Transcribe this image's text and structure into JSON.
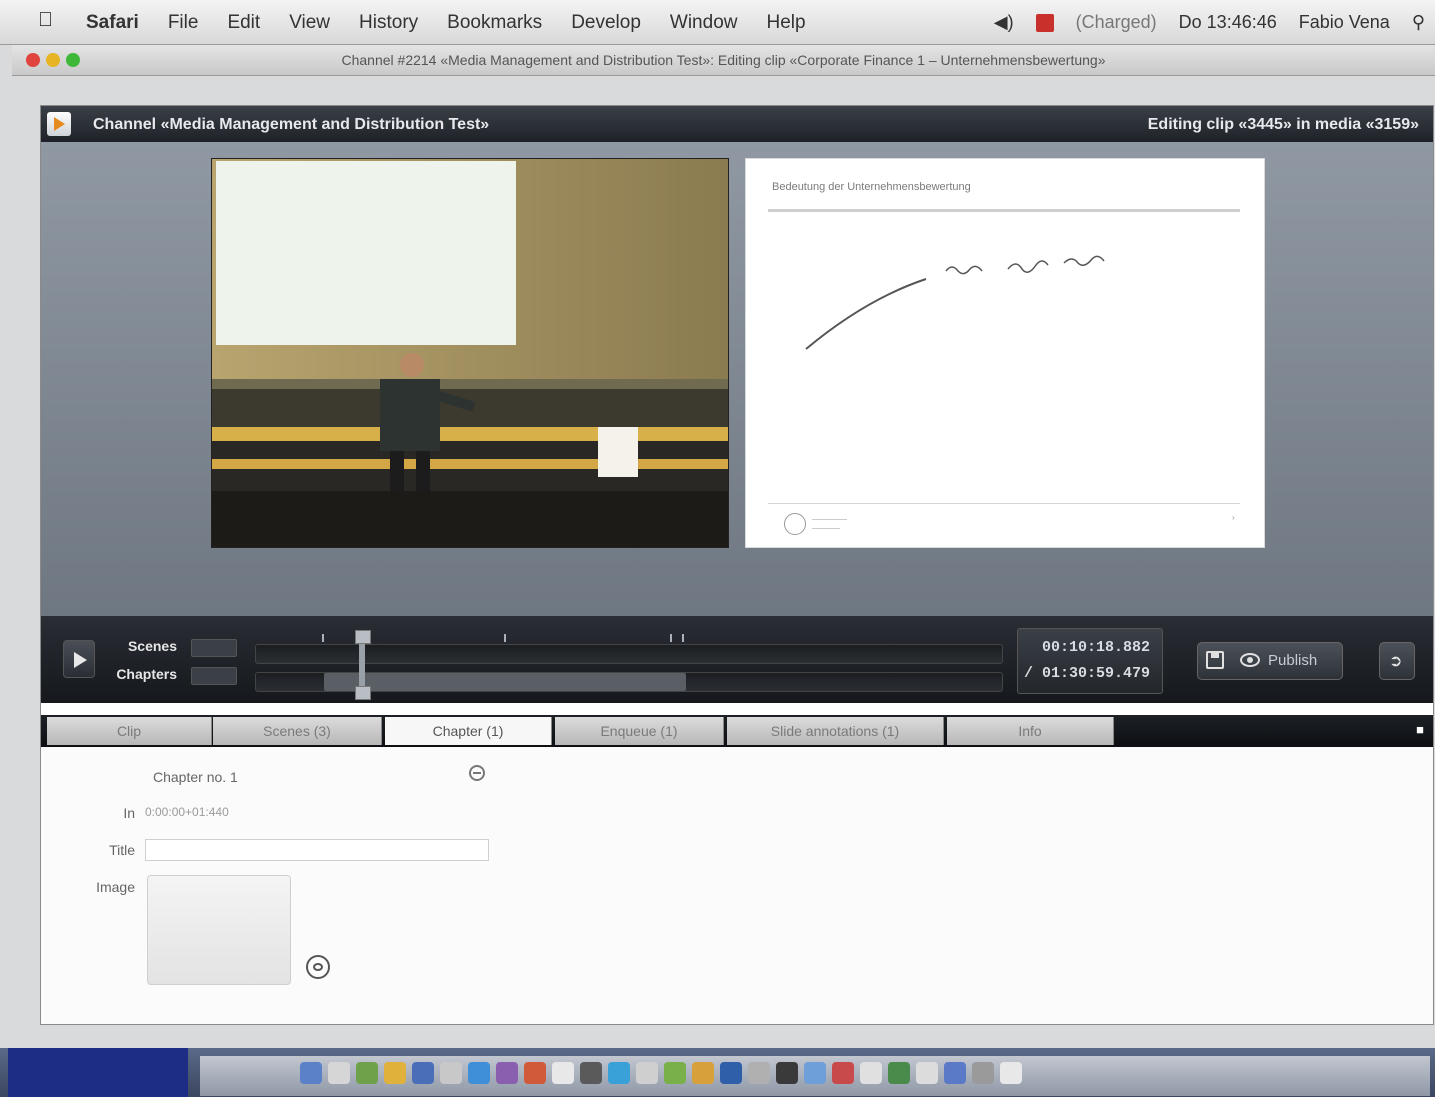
{
  "menubar": {
    "items": [
      "Safari",
      "File",
      "Edit",
      "View",
      "History",
      "Bookmarks",
      "Develop",
      "Window",
      "Help"
    ],
    "battery": "(Charged)",
    "clock": "Do 13:46:46",
    "user": "Fabio Vena"
  },
  "window": {
    "title": "Channel #2214 «Media Management and Distribution Test»: Editing clip «Corporate Finance 1 – Unternehmensbewertung»"
  },
  "app": {
    "channel_title": "Channel «Media Management and Distribution Test»",
    "editing_title": "Editing clip «3445» in media «3159»",
    "slide_heading": "Bedeutung der Unternehmensbewertung"
  },
  "timeline": {
    "scenes_label": "Scenes",
    "chapters_label": "Chapters",
    "current_time": "00:10:18.882",
    "duration": "/ 01:30:59.479",
    "publish_label": "Publish"
  },
  "tabs": [
    {
      "label": "Clip",
      "active": false
    },
    {
      "label": "Scenes (3)",
      "active": false
    },
    {
      "label": "Chapter (1)",
      "active": true
    },
    {
      "label": "Enqueue (1)",
      "active": false
    },
    {
      "label": "Slide annotations (1)",
      "active": false
    },
    {
      "label": "Info",
      "active": false
    }
  ],
  "chapter_form": {
    "heading": "Chapter no. 1",
    "in_label": "In",
    "in_value": "0:00:00+01:440",
    "title_label": "Title",
    "title_value": "",
    "image_label": "Image"
  },
  "colors": {
    "header_dark": "#1e2228",
    "stage_gray": "#7e8792",
    "active_tab": "#f7f7f7"
  }
}
